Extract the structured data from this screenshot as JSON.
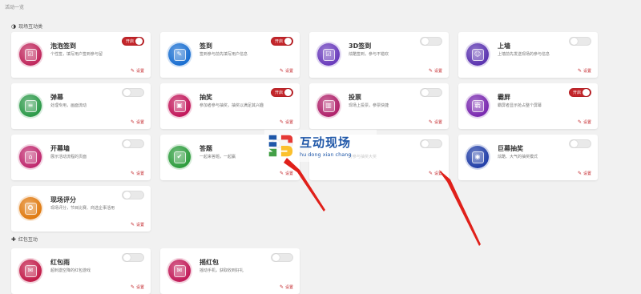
{
  "page_title": "活动一览",
  "sections": [
    {
      "icon": "◑",
      "label": "现场互动类"
    },
    {
      "icon": "✚",
      "label": "红包互动"
    }
  ],
  "watermark": {
    "chinese": "互动现场",
    "pinyin": "hu dong xian chang"
  },
  "setting_label": "设置",
  "on_label": "开启",
  "cards": [
    {
      "name": "泡泡签到",
      "desc": "个性签，填写用户签到参与留",
      "on": true,
      "color": "#c0285d",
      "glyph": "☑"
    },
    {
      "name": "签到",
      "desc": "签到参与前先填写用户信息",
      "on": true,
      "color": "#1a6fd1",
      "glyph": "✎"
    },
    {
      "name": "3D签到",
      "desc": "炫酷签到，参与不错欢",
      "on": false,
      "color": "#6a3cbc",
      "glyph": "☑"
    },
    {
      "name": "上墙",
      "desc": "上墙前先发送现场的参与信息",
      "on": false,
      "color": "#5b34b0",
      "glyph": "☺"
    },
    {
      "name": "弹幕",
      "desc": "处理专用，画面流动",
      "on": false,
      "color": "#2d9a4a",
      "glyph": "≡"
    },
    {
      "name": "抽奖",
      "desc": "参加者参与抽奖，抽奖以满足其兴趣",
      "on": true,
      "color": "#c2185b",
      "glyph": "▣"
    },
    {
      "name": "投票",
      "desc": "现场上投票，参票快捷",
      "on": false,
      "color": "#b0236b",
      "glyph": "▥"
    },
    {
      "name": "霸屏",
      "desc": "霸屏者显示抢占整个屏幕",
      "on": true,
      "color": "#7a2ab0",
      "glyph": "霸"
    },
    {
      "name": "开幕墙",
      "desc": "展示活动流程的页面",
      "on": false,
      "color": "#c02a6f",
      "glyph": "⌂"
    },
    {
      "name": "答题",
      "desc": "一起来答题，一起赢",
      "on": false,
      "color": "#2e9d3e",
      "glyph": "✔"
    },
    {
      "name": "",
      "desc": "可参与抽奖大奖",
      "on": false,
      "color": "#ffffff",
      "glyph": ""
    },
    {
      "name": "巨幕抽奖",
      "desc": "炫酷、大气的抽奖模式",
      "on": false,
      "color": "#2340a8",
      "glyph": "◉"
    },
    {
      "name": "现场评分",
      "desc": "现场评分，节目比赛、商选企事活用",
      "on": false,
      "color": "#e07b12",
      "glyph": "✪"
    },
    {
      "name": "红包雨",
      "desc": "超刺激空降的红包游戏",
      "on": false,
      "color": "#c21d4a",
      "glyph": "✉"
    },
    {
      "name": "摇红包",
      "desc": "摇动手机，获取收到好礼",
      "on": false,
      "color": "#c21d5a",
      "glyph": "✉"
    }
  ]
}
